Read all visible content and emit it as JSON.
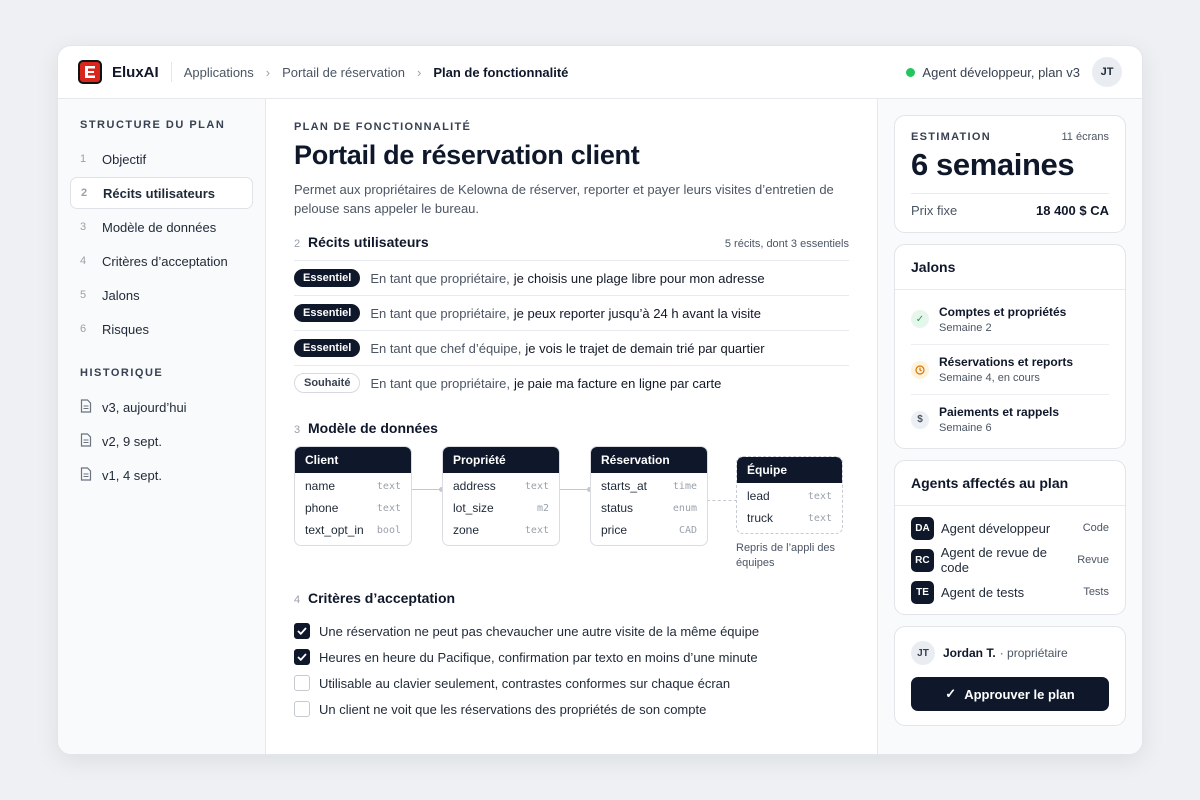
{
  "brand": {
    "name": "EluxAI",
    "color": "#d9261c"
  },
  "breadcrumb": [
    "Applications",
    "Portail de réservation",
    "Plan de fonctionnalité"
  ],
  "agent_status": {
    "label": "Agent développeur, plan v3",
    "color": "#22c55e"
  },
  "user_initials": "JT",
  "sidebar": {
    "structure_title": "STRUCTURE DU PLAN",
    "items": [
      {
        "num": "1",
        "label": "Objectif"
      },
      {
        "num": "2",
        "label": "Récits utilisateurs"
      },
      {
        "num": "3",
        "label": "Modèle de données"
      },
      {
        "num": "4",
        "label": "Critères d’acceptation"
      },
      {
        "num": "5",
        "label": "Jalons"
      },
      {
        "num": "6",
        "label": "Risques"
      }
    ],
    "history_title": "HISTORIQUE",
    "history": [
      "v3, aujourd’hui",
      "v2, 9 sept.",
      "v1, 4 sept."
    ]
  },
  "main": {
    "eyebrow": "PLAN DE FONCTIONNALITÉ",
    "title": "Portail de réservation client",
    "description": "Permet aux propriétaires de Kelowna de réserver, reporter et payer leurs visites d’entretien de pelouse sans appeler le bureau.",
    "stories_section": {
      "num": "2",
      "title": "Récits utilisateurs",
      "meta": "5 récits, dont 3 essentiels"
    },
    "stories": [
      {
        "badge": "Essentiel",
        "prefix": "En tant que propriétaire,",
        "text": "je choisis une plage libre pour mon adresse"
      },
      {
        "badge": "Essentiel",
        "prefix": "En tant que propriétaire,",
        "text": "je peux reporter jusqu’à 24 h avant la visite"
      },
      {
        "badge": "Essentiel",
        "prefix": "En tant que chef d’équipe,",
        "text": "je vois le trajet de demain trié par quartier"
      },
      {
        "badge": "Souhaité",
        "prefix": "En tant que propriétaire,",
        "text": "je paie ma facture en ligne par carte"
      }
    ],
    "model_section": {
      "num": "3",
      "title": "Modèle de données"
    },
    "entities": [
      {
        "name": "Client",
        "fields": [
          [
            "name",
            "text"
          ],
          [
            "phone",
            "text"
          ],
          [
            "text_opt_in",
            "bool"
          ]
        ]
      },
      {
        "name": "Propriété",
        "fields": [
          [
            "address",
            "text"
          ],
          [
            "lot_size",
            "m2"
          ],
          [
            "zone",
            "text"
          ]
        ]
      },
      {
        "name": "Réservation",
        "fields": [
          [
            "starts_at",
            "time"
          ],
          [
            "status",
            "enum"
          ],
          [
            "price",
            "CAD"
          ]
        ]
      },
      {
        "name": "Équipe",
        "fields": [
          [
            "lead",
            "text"
          ],
          [
            "truck",
            "text"
          ]
        ]
      }
    ],
    "entity_note": "Repris de l’appli des équipes",
    "criteria_section": {
      "num": "4",
      "title": "Critères d’acceptation"
    },
    "criteria": [
      {
        "checked": true,
        "text": "Une réservation ne peut pas chevaucher une autre visite de la même équipe"
      },
      {
        "checked": true,
        "text": "Heures en heure du Pacifique, confirmation par texto en moins d’une minute"
      },
      {
        "checked": false,
        "text": "Utilisable au clavier seulement, contrastes conformes sur chaque écran"
      },
      {
        "checked": false,
        "text": "Un client ne voit que les réservations des propriétés de son compte"
      }
    ]
  },
  "estimate": {
    "label": "ESTIMATION",
    "screens": "11 écrans",
    "duration": "6 semaines",
    "fixed_label": "Prix fixe",
    "fixed_value": "18 400 $ CA"
  },
  "milestones": {
    "title": "Jalons",
    "items": [
      {
        "status": "done",
        "icon": "check-icon",
        "title": "Comptes et propriétés",
        "sub": "Semaine 2"
      },
      {
        "status": "in-progress",
        "icon": "clock-icon",
        "title": "Réservations et reports",
        "sub": "Semaine 4, en cours"
      },
      {
        "status": "upcoming",
        "icon": "dollar-icon",
        "title": "Paiements et rappels",
        "sub": "Semaine 6"
      }
    ]
  },
  "agents": {
    "title": "Agents affectés au plan",
    "items": [
      {
        "initials": "DA",
        "name": "Agent développeur",
        "role": "Code"
      },
      {
        "initials": "RC",
        "name": "Agent de revue de code",
        "role": "Revue"
      },
      {
        "initials": "TE",
        "name": "Agent de tests",
        "role": "Tests"
      }
    ]
  },
  "approval": {
    "user_initials": "JT",
    "user_name": "Jordan T.",
    "user_role": "· propriétaire",
    "button": "Approuver le plan"
  }
}
